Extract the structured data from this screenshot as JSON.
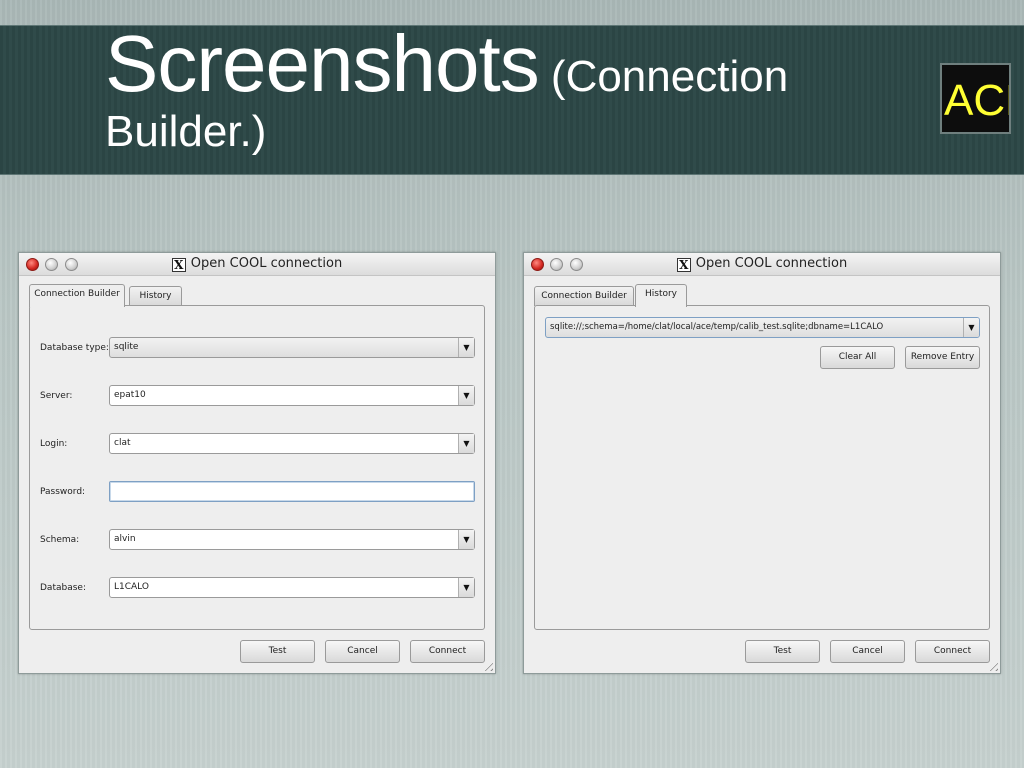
{
  "slide": {
    "title_main": "Screenshots",
    "title_paren": " (Connection",
    "title_line2": "Builder.)",
    "logo_text": "ACE"
  },
  "left_window": {
    "title": "Open COOL connection",
    "tabs": [
      "Connection Builder",
      "History"
    ],
    "active_tab": "Connection Builder",
    "fields": {
      "database_type": {
        "label": "Database type:",
        "value": "sqlite"
      },
      "server": {
        "label": "Server:",
        "value": "epat10"
      },
      "login": {
        "label": "Login:",
        "value": "clat"
      },
      "password": {
        "label": "Password:",
        "value": ""
      },
      "schema": {
        "label": "Schema:",
        "value": "alvin"
      },
      "database": {
        "label": "Database:",
        "value": "L1CALO"
      }
    },
    "buttons": {
      "test": "Test",
      "cancel": "Cancel",
      "connect": "Connect"
    }
  },
  "right_window": {
    "title": "Open COOL connection",
    "tabs": [
      "Connection Builder",
      "History"
    ],
    "active_tab": "History",
    "history_selected": "sqlite://;schema=/home/clat/local/ace/temp/calib_test.sqlite;dbname=L1CALO",
    "clear_all": "Clear All",
    "remove_entry": "Remove Entry",
    "buttons": {
      "test": "Test",
      "cancel": "Cancel",
      "connect": "Connect"
    }
  },
  "colors": {
    "banner": "#2d4746",
    "background": "#b9c6c4",
    "logo_text": "#ffff33",
    "close_button": "#d2261f"
  },
  "icons": [
    "x11-icon",
    "close-icon",
    "minimize-icon",
    "maximize-icon",
    "chevron-down-icon",
    "resize-grip-icon"
  ]
}
